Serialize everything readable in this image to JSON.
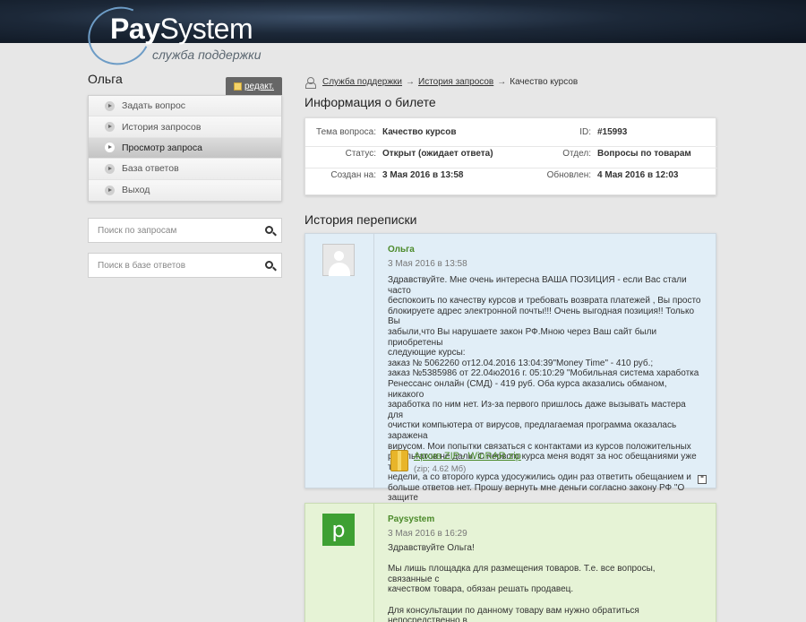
{
  "header": {
    "logo_pay": "Pay",
    "logo_system": "System",
    "logo_subtitle": "служба поддержки"
  },
  "sidebar": {
    "user_name": "Ольга",
    "edit_label": "редакт.",
    "menu": [
      {
        "label": "Задать вопрос",
        "active": false
      },
      {
        "label": "История запросов",
        "active": false
      },
      {
        "label": "Просмотр запроса",
        "active": true
      },
      {
        "label": "База ответов",
        "active": false
      },
      {
        "label": "Выход",
        "active": false
      }
    ],
    "search_requests_placeholder": "Поиск по запросам",
    "search_answers_placeholder": "Поиск в базе ответов"
  },
  "breadcrumb": {
    "items": [
      "Служба поддержки",
      "История запросов"
    ],
    "separator": "→",
    "current": "Качество курсов"
  },
  "ticket": {
    "title": "Информация о билете",
    "topic_label": "Тема вопроса:",
    "topic": "Качество курсов",
    "id_label": "ID:",
    "id": "#15993",
    "status_label": "Статус:",
    "status": "Открыт (ожидает ответа)",
    "dept_label": "Отдел:",
    "dept": "Вопросы по товарам",
    "created_label": "Создан на:",
    "created": "3 Мая 2016 в 13:58",
    "updated_label": "Обновлен:",
    "updated": "4 Мая 2016 в 12:03"
  },
  "history": {
    "title": "История переписки",
    "messages": [
      {
        "author": "Ольга",
        "date": "3 Мая 2016 в 13:58",
        "body": "Здравствуйте. Мне очень интересна ВАША ПОЗИЦИЯ - если Вас стали часто\nбеспокоить по качеству курсов и требовать возврата платежей , Вы просто\nблокируете адрес электронной почты!!! Очень выгодная позиция!! Только Вы\nзабыли,что Вы нарушаете закон РФ.Мною через Ваш сайт были приобретены\nследующие курсы:\nзаказ № 5062260 от12.04.2016 13:04:39\"Money Time\" - 410 руб.;\nзаказ №5385986 от 22.04ю2016 г. 05:10:29 \"Мобильная система хаработка\nРенессанс онлайн (СМД) - 419 руб. Оба курса аказались обманом, никакого\nзаработка по ним нет. Из-за первого пришлось даже вызывать мастера для\nочистки компьютера от вирусов, предлагаемая программа оказалась заражена\nвирусом. Мои попытки связаться с контактами из курсов положительных\nрезультатов не дали. С первого курса меня водят за нос обещаниями уже три\nнедели, а со второго курса удосужились один раз ответить обещанием и\nбольше ответов нет. Прошу вернуть мне деньги согласно закону РФ \"О защите\nправ потребителей\" Мой кошелек Webmoney R716535123379 или Яндекс\n41001638601839 за оба курса Прилагаю архив моих скриншотов переписки по 1\nи 2 курсам. Я сделала скриншот и этого к Вам обращения.",
        "attachment_name": "Архив ZIP - WinRAR.zip",
        "attachment_size": "(zip; 4.62 Мб)"
      },
      {
        "author": "Paysystem",
        "avatar_letter": "p",
        "date": "3 Мая 2016 в 16:29",
        "body": "Здравствуйте Ольга!\n\nМы лишь площадка для размещения товаров. Т.е. все вопросы, связанные с\nкачеством товара, обязан решать продавец.\n\nДля консультации по данному товару вам нужно обратиться непосредственно в\nподдержку того сайта, на котором продается товар/услуга."
      }
    ]
  },
  "colors": {
    "header_bg": "#1c2838",
    "author_green": "#4b8a2a",
    "user_msg_bg": "#e1eef7",
    "support_msg_bg": "#e6f3d6",
    "support_avatar": "#3ea033"
  }
}
